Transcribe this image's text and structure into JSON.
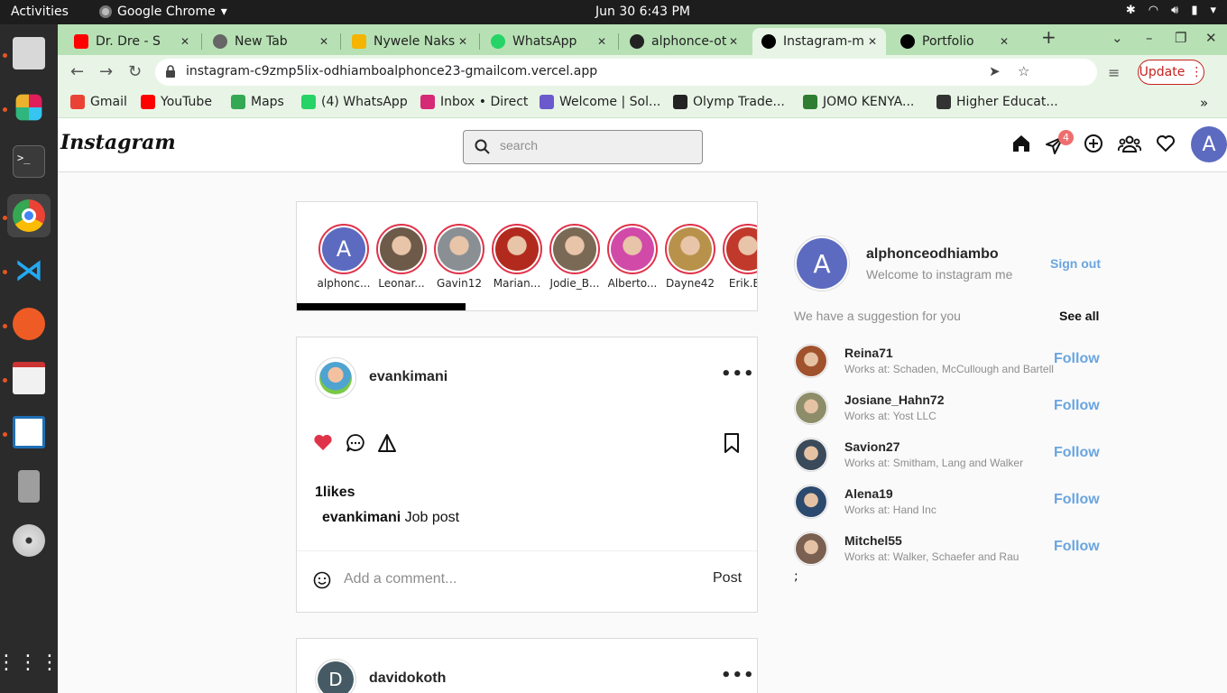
{
  "system": {
    "activities": "Activities",
    "app_name": "Google Chrome",
    "clock": "Jun 30   6:43 PM"
  },
  "browser": {
    "tabs": [
      {
        "title": "Dr. Dre - S",
        "favicon": "youtube-icon",
        "color": "#ff0000"
      },
      {
        "title": "New Tab",
        "favicon": "chrome-icon",
        "color": "#666666"
      },
      {
        "title": "Nywele Naks",
        "favicon": "slides-icon",
        "color": "#f4b400"
      },
      {
        "title": "WhatsApp",
        "favicon": "whatsapp-icon",
        "color": "#25d366"
      },
      {
        "title": "alphonce-oti",
        "favicon": "github-icon",
        "color": "#222222"
      },
      {
        "title": "Instagram-m",
        "favicon": "vercel-icon",
        "color": "#000000"
      },
      {
        "title": "Portfolio",
        "favicon": "vercel-icon",
        "color": "#000000"
      }
    ],
    "url": "instagram-c9zmp5lix-odhiamboalphonce23-gmailcom.vercel.app",
    "update_label": "Update",
    "bookmarks": [
      {
        "label": "Gmail",
        "color": "#ea4335"
      },
      {
        "label": "YouTube",
        "color": "#ff0000"
      },
      {
        "label": "Maps",
        "color": "#34a853"
      },
      {
        "label": "(4) WhatsApp",
        "color": "#25d366"
      },
      {
        "label": "Inbox • Direct",
        "color": "#d62976"
      },
      {
        "label": "Welcome | Sol...",
        "color": "#6a5acd"
      },
      {
        "label": "Olymp Trade...",
        "color": "#222222"
      },
      {
        "label": "JOMO KENYA...",
        "color": "#2e7d32"
      },
      {
        "label": "Higher Educat...",
        "color": "#333333"
      }
    ],
    "more_bookmarks": "»"
  },
  "instagram": {
    "logo": "Instagram",
    "search_placeholder": "search",
    "notification_count": "4",
    "header_avatar_initial": "A",
    "stories": [
      {
        "name": "alphonc...",
        "initial": "A",
        "color": "#5c6bc0"
      },
      {
        "name": "Leonar...",
        "color": "#6d5a48"
      },
      {
        "name": "Gavin12",
        "color": "#8a8f94"
      },
      {
        "name": "Marian...",
        "color": "#b22a1e"
      },
      {
        "name": "Jodie_B...",
        "color": "#7a6a55"
      },
      {
        "name": "Alberto...",
        "color": "#d14aa8"
      },
      {
        "name": "Dayne42",
        "color": "#b8924a"
      },
      {
        "name": "Erik.Bo",
        "color": "#c0392b"
      }
    ],
    "posts": [
      {
        "user": "evankimani",
        "likes": "1likes",
        "caption_user": "evankimani",
        "caption_text": "Job post",
        "comment_placeholder": "Add a comment...",
        "post_label": "Post",
        "avatar_color": "#4fa3d1"
      },
      {
        "user": "davidokoth",
        "avatar_initial": "D",
        "avatar_color": "#455a64"
      }
    ],
    "sidebar": {
      "username": "alphonceodhiambo",
      "subtitle": "Welcome to instagram me",
      "avatar_initial": "A",
      "signout": "Sign out",
      "suggestion_title": "We have a suggestion for you",
      "see_all": "See all",
      "suggestions": [
        {
          "name": "Reina71",
          "works": "Works at: Schaden, McCullough and Bartell",
          "follow": "Follow",
          "color": "#a0522d"
        },
        {
          "name": "Josiane_Hahn72",
          "works": "Works at: Yost LLC",
          "follow": "Follow",
          "color": "#8d8d6a"
        },
        {
          "name": "Savion27",
          "works": "Works at: Smitham, Lang and Walker",
          "follow": "Follow",
          "color": "#3a4a5a"
        },
        {
          "name": "Alena19",
          "works": "Works at: Hand Inc",
          "follow": "Follow",
          "color": "#2c4a6e"
        },
        {
          "name": "Mitchel55",
          "works": "Works at: Walker, Schaefer and Rau",
          "follow": "Follow",
          "color": "#7a6050"
        }
      ],
      "stray_char": ";"
    }
  },
  "colors": {
    "accent_link": "#6aa5e0",
    "like_red": "#e0334a",
    "tabstrip_green": "#b7e1b4"
  }
}
